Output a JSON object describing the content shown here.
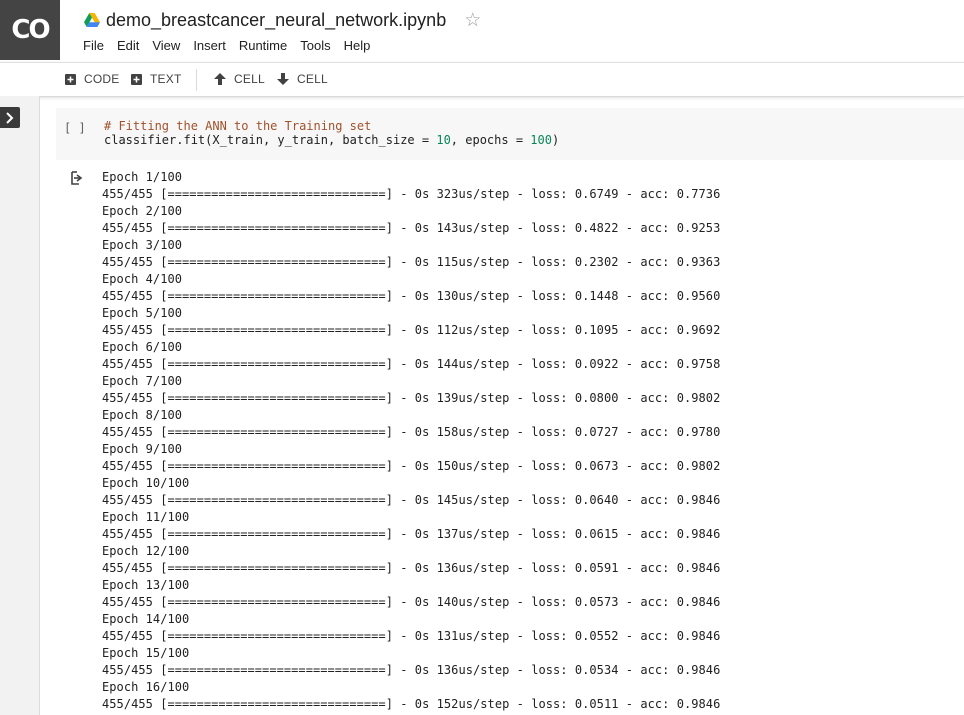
{
  "app": {
    "logo_text": "CO",
    "notebook_title": "demo_breastcancer_neural_network.ipynb",
    "menu": [
      "File",
      "Edit",
      "View",
      "Insert",
      "Runtime",
      "Tools",
      "Help"
    ]
  },
  "toolbar": {
    "code_label": "CODE",
    "text_label": "TEXT",
    "cell_up_label": "CELL",
    "cell_down_label": "CELL"
  },
  "cell": {
    "run_indicator": "[ ]",
    "code_comment": "# Fitting the ANN to the Training set",
    "code_line_prefix": "classifier.fit(X_train, y_train, batch_size = ",
    "code_batch_size": "10",
    "code_line_middle": ", epochs = ",
    "code_epochs": "100",
    "code_line_suffix": ")"
  },
  "output": {
    "lines": [
      "Epoch 1/100",
      "455/455 [==============================] - 0s 323us/step - loss: 0.6749 - acc: 0.7736",
      "Epoch 2/100",
      "455/455 [==============================] - 0s 143us/step - loss: 0.4822 - acc: 0.9253",
      "Epoch 3/100",
      "455/455 [==============================] - 0s 115us/step - loss: 0.2302 - acc: 0.9363",
      "Epoch 4/100",
      "455/455 [==============================] - 0s 130us/step - loss: 0.1448 - acc: 0.9560",
      "Epoch 5/100",
      "455/455 [==============================] - 0s 112us/step - loss: 0.1095 - acc: 0.9692",
      "Epoch 6/100",
      "455/455 [==============================] - 0s 144us/step - loss: 0.0922 - acc: 0.9758",
      "Epoch 7/100",
      "455/455 [==============================] - 0s 139us/step - loss: 0.0800 - acc: 0.9802",
      "Epoch 8/100",
      "455/455 [==============================] - 0s 158us/step - loss: 0.0727 - acc: 0.9780",
      "Epoch 9/100",
      "455/455 [==============================] - 0s 150us/step - loss: 0.0673 - acc: 0.9802",
      "Epoch 10/100",
      "455/455 [==============================] - 0s 145us/step - loss: 0.0640 - acc: 0.9846",
      "Epoch 11/100",
      "455/455 [==============================] - 0s 137us/step - loss: 0.0615 - acc: 0.9846",
      "Epoch 12/100",
      "455/455 [==============================] - 0s 136us/step - loss: 0.0591 - acc: 0.9846",
      "Epoch 13/100",
      "455/455 [==============================] - 0s 140us/step - loss: 0.0573 - acc: 0.9846",
      "Epoch 14/100",
      "455/455 [==============================] - 0s 131us/step - loss: 0.0552 - acc: 0.9846",
      "Epoch 15/100",
      "455/455 [==============================] - 0s 136us/step - loss: 0.0534 - acc: 0.9846",
      "Epoch 16/100",
      "455/455 [==============================] - 0s 152us/step - loss: 0.0511 - acc: 0.9846"
    ]
  },
  "icons": {
    "logo": "colab-logo",
    "drive": "google-drive-icon",
    "star": "star-outline-icon",
    "add": "plus-box-icon",
    "up": "arrow-up-icon",
    "down": "arrow-down-icon",
    "panel": "chevron-right-icon",
    "output": "output-arrow-icon"
  },
  "colors": {
    "logo_bg": "#444444",
    "comment": "#a0522d",
    "number": "#098658"
  }
}
